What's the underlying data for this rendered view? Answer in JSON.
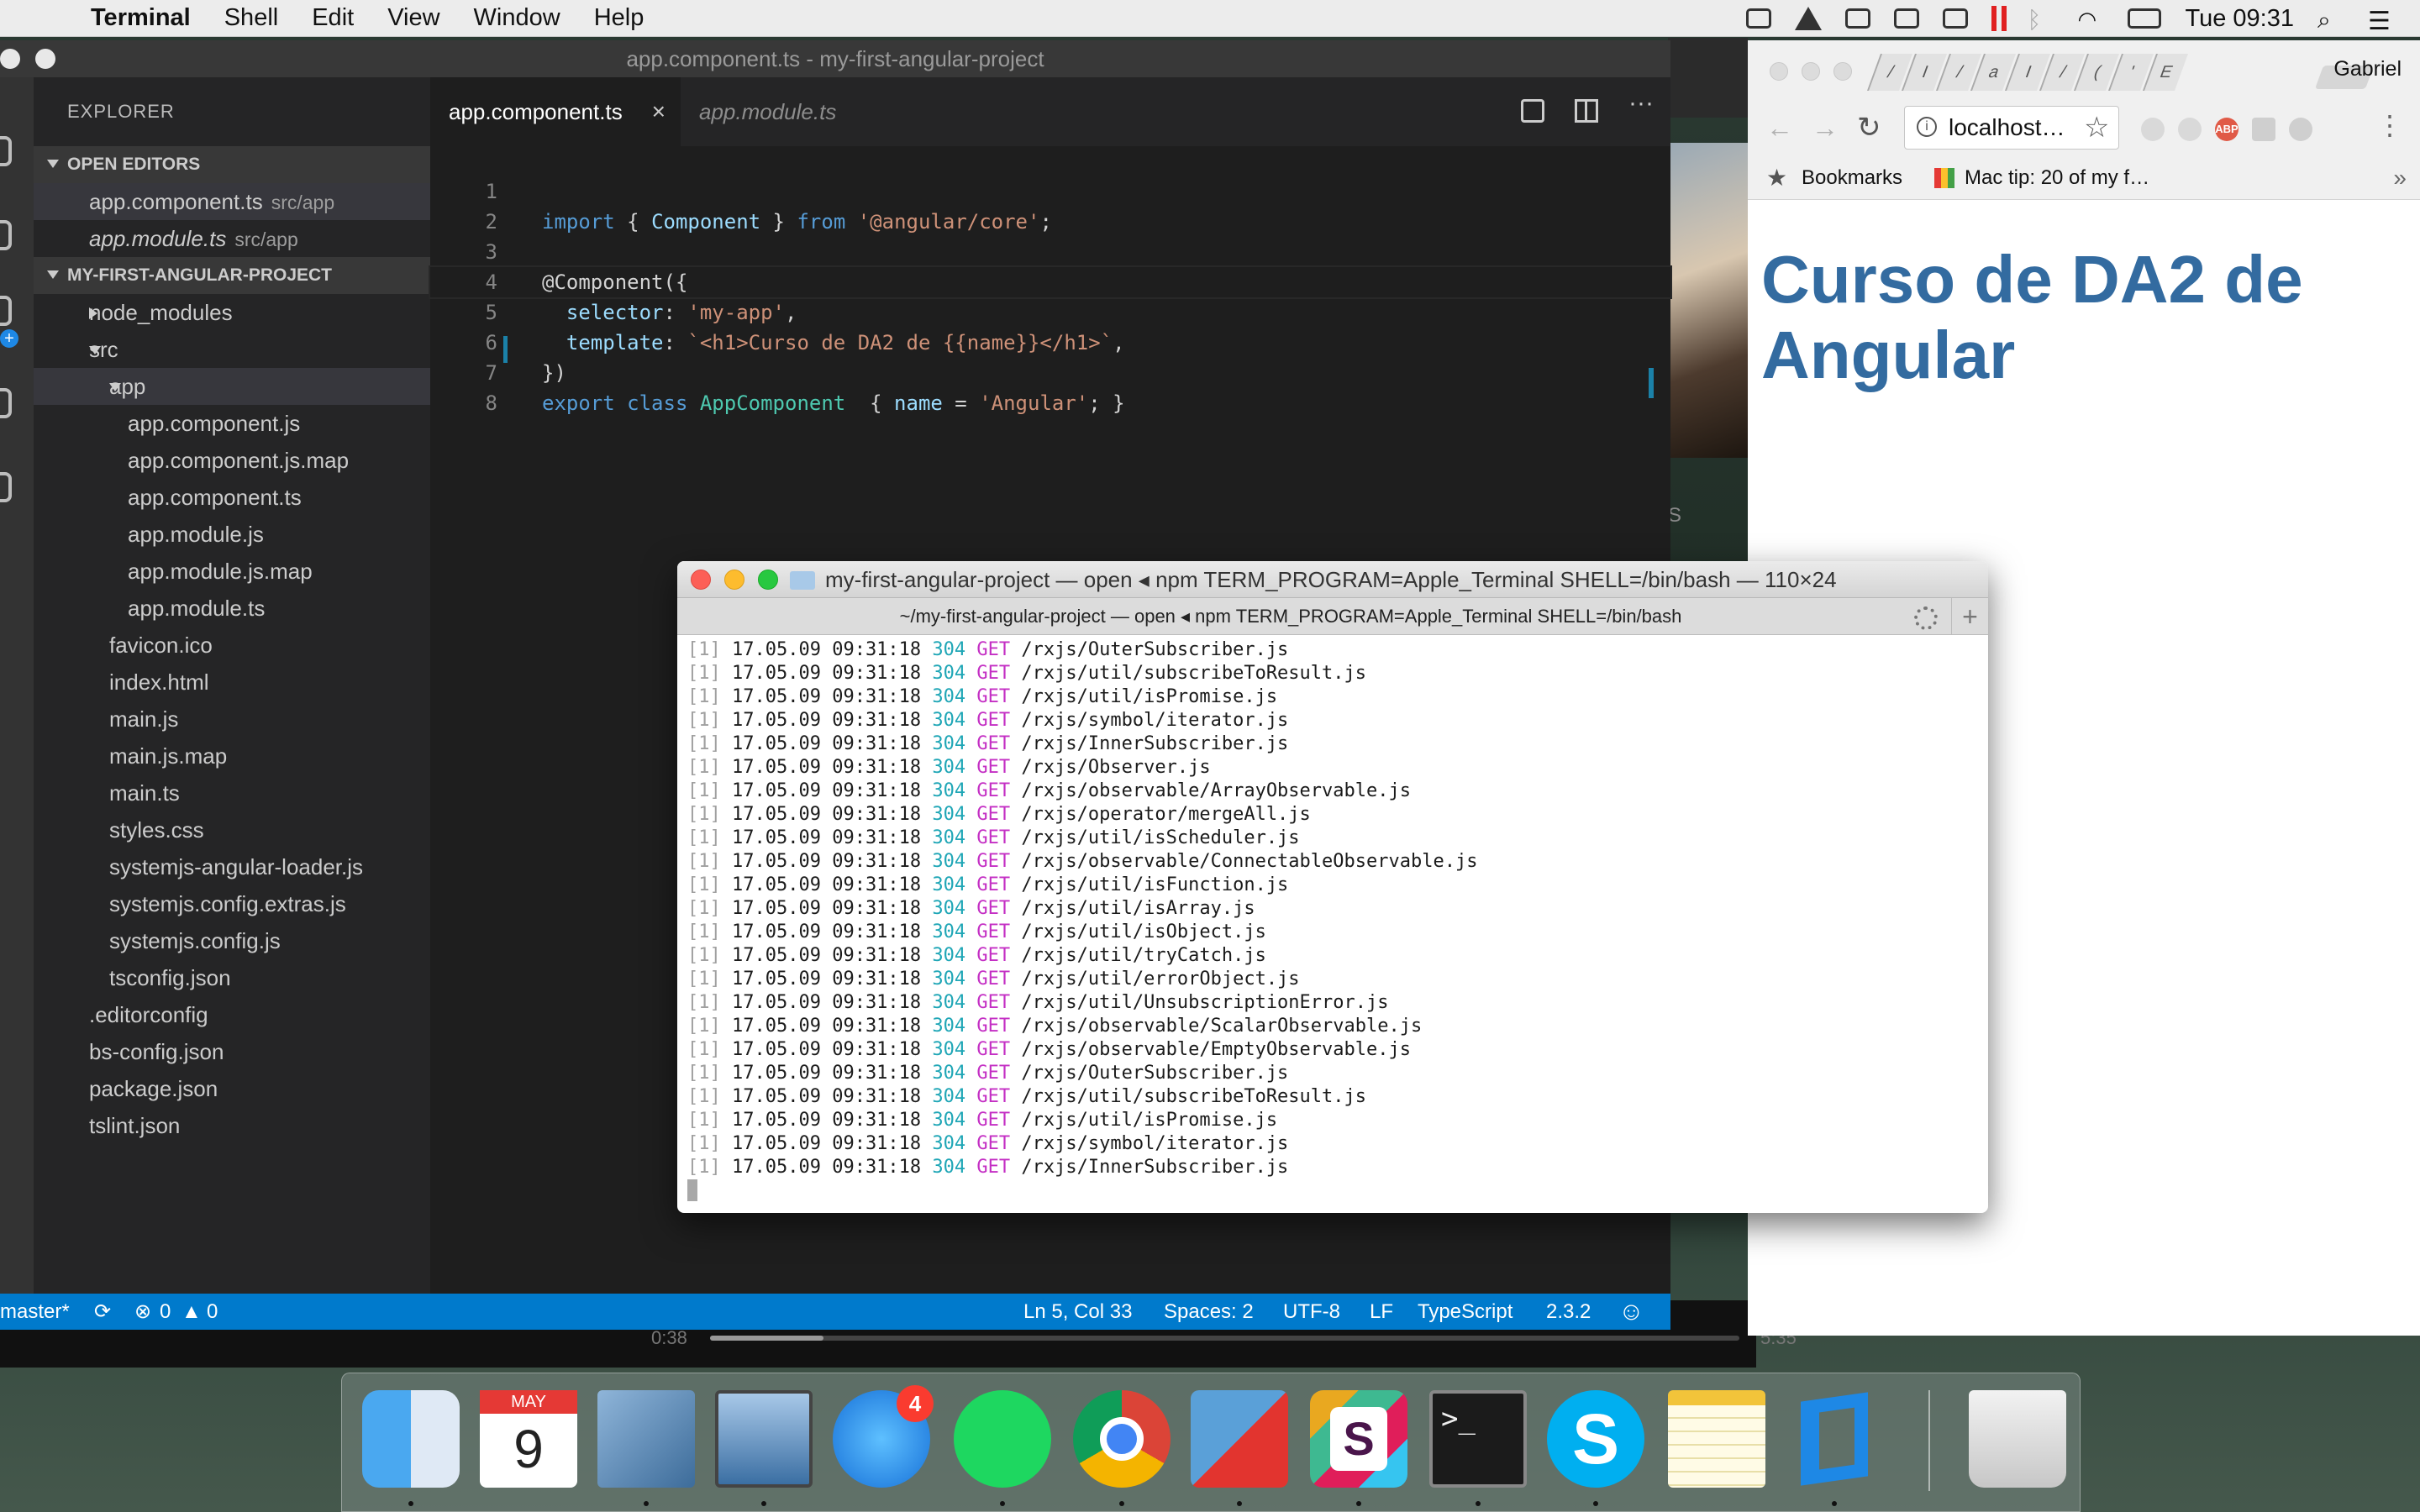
{
  "menubar": {
    "app_name": "Terminal",
    "items": [
      "Shell",
      "Edit",
      "View",
      "Window",
      "Help"
    ],
    "clock": "Tue 09:31",
    "status_icons": [
      "dropbox-icon",
      "drive-icon",
      "chat-icon",
      "creative-cloud-icon",
      "copy-icon",
      "pause-icon",
      "bluetooth-icon",
      "wifi-icon",
      "battery-icon",
      "search-icon",
      "list-icon"
    ]
  },
  "vscode": {
    "title": "app.component.ts - my-first-angular-project",
    "explorer_title": "EXPLORER",
    "open_editors_header": "OPEN EDITORS",
    "open_editors": [
      {
        "name": "app.component.ts",
        "path": "src/app"
      },
      {
        "name": "app.module.ts",
        "path": "src/app"
      }
    ],
    "project_header": "MY-FIRST-ANGULAR-PROJECT",
    "tree": {
      "node_modules": "node_modules",
      "src": "src",
      "app": "app",
      "app_files": [
        "app.component.js",
        "app.component.js.map",
        "app.component.ts",
        "app.module.js",
        "app.module.js.map",
        "app.module.ts"
      ],
      "src_files": [
        "favicon.ico",
        "index.html",
        "main.js",
        "main.js.map",
        "main.ts",
        "styles.css",
        "systemjs-angular-loader.js",
        "systemjs.config.extras.js",
        "systemjs.config.js",
        "tsconfig.json"
      ],
      "root_files": [
        ".editorconfig",
        "bs-config.json",
        "package.json",
        "tslint.json"
      ]
    },
    "tabs": {
      "active": "app.component.ts",
      "close": "×",
      "inactive": "app.module.ts"
    },
    "code_line_numbers": [
      "1",
      "2",
      "3",
      "4",
      "5",
      "6",
      "7",
      "8"
    ],
    "code": {
      "l1": {
        "kw": "import",
        "p1": " { ",
        "cls": "Component",
        "p2": " } ",
        "kw2": "from",
        "sp": " ",
        "str": "'@angular/core'",
        "end": ";"
      },
      "l3": {
        "dec": "@Component",
        "end": "({"
      },
      "l4": {
        "indent": "  ",
        "prop": "selector",
        "colon": ": ",
        "str": "'my-app'",
        "end": ","
      },
      "l5": {
        "indent": "  ",
        "prop": "template",
        "colon": ": ",
        "str": "`<h1>Curso de DA2 de {{name}}</h1>`",
        "end": ","
      },
      "l6": {
        "text": "})"
      },
      "l7": {
        "kw": "export",
        "sp": " ",
        "kw2": "class",
        "sp2": " ",
        "cls": "AppComponent",
        "p1": "  { ",
        "prop": "name",
        "p2": " = ",
        "str": "'Angular'",
        "end": "; }"
      }
    },
    "status": {
      "branch": "master*",
      "errors": "0",
      "warnings": "0",
      "position": "Ln 5, Col 33",
      "spaces": "Spaces: 2",
      "encoding": "UTF-8",
      "eol": "LF",
      "language": "TypeScript",
      "version": "2.3.2"
    }
  },
  "chrome": {
    "user": "Gabriel",
    "tab_letters": [
      "/",
      "I",
      "/",
      "a",
      "I",
      "/",
      "(",
      "'",
      "E"
    ],
    "omnibox": "localhost…",
    "bookmarks_label": "Bookmarks",
    "bookmark_tip": "Mac tip: 20 of my f…",
    "more": "»",
    "page_heading": "Curso de DA2 de Angular"
  },
  "terminal": {
    "title": "my-first-angular-project — open ◂ npm TERM_PROGRAM=Apple_Terminal SHELL=/bin/bash — 110×24",
    "tab_title": "~/my-first-angular-project — open ◂ npm TERM_PROGRAM=Apple_Terminal SHELL=/bin/bash",
    "plus": "+",
    "log_index": "[1]",
    "log_time": "17.05.09 09:31:18",
    "log_status": "304",
    "log_method": "GET",
    "log_paths": [
      "/rxjs/OuterSubscriber.js",
      "/rxjs/util/subscribeToResult.js",
      "/rxjs/util/isPromise.js",
      "/rxjs/symbol/iterator.js",
      "/rxjs/InnerSubscriber.js",
      "/rxjs/Observer.js",
      "/rxjs/observable/ArrayObservable.js",
      "/rxjs/operator/mergeAll.js",
      "/rxjs/util/isScheduler.js",
      "/rxjs/observable/ConnectableObservable.js",
      "/rxjs/util/isFunction.js",
      "/rxjs/util/isArray.js",
      "/rxjs/util/isObject.js",
      "/rxjs/util/tryCatch.js",
      "/rxjs/util/errorObject.js",
      "/rxjs/util/UnsubscriptionError.js",
      "/rxjs/observable/ScalarObservable.js",
      "/rxjs/observable/EmptyObservable.js",
      "/rxjs/OuterSubscriber.js",
      "/rxjs/util/subscribeToResult.js",
      "/rxjs/util/isPromise.js",
      "/rxjs/symbol/iterator.js",
      "/rxjs/InnerSubscriber.js"
    ]
  },
  "background": {
    "video_time_left": "0:38",
    "video_time_right": "5:35",
    "video_progress": 0.11,
    "bg_letter": "S"
  },
  "dock": {
    "calendar_month": "MAY",
    "calendar_day": "9",
    "app_store_badge": "4",
    "terminal_prompt": ">_",
    "skype_letter": "S",
    "slack_letter": "S",
    "apps": [
      "finder-icon",
      "calendar-icon",
      "preview-icon",
      "system-prefs-icon",
      "app-store-icon",
      "spotify-icon",
      "chrome-icon",
      "vmware-icon",
      "slack-icon",
      "terminal-icon",
      "skype-icon",
      "notes-icon",
      "vscode-icon",
      "trash-icon"
    ]
  }
}
